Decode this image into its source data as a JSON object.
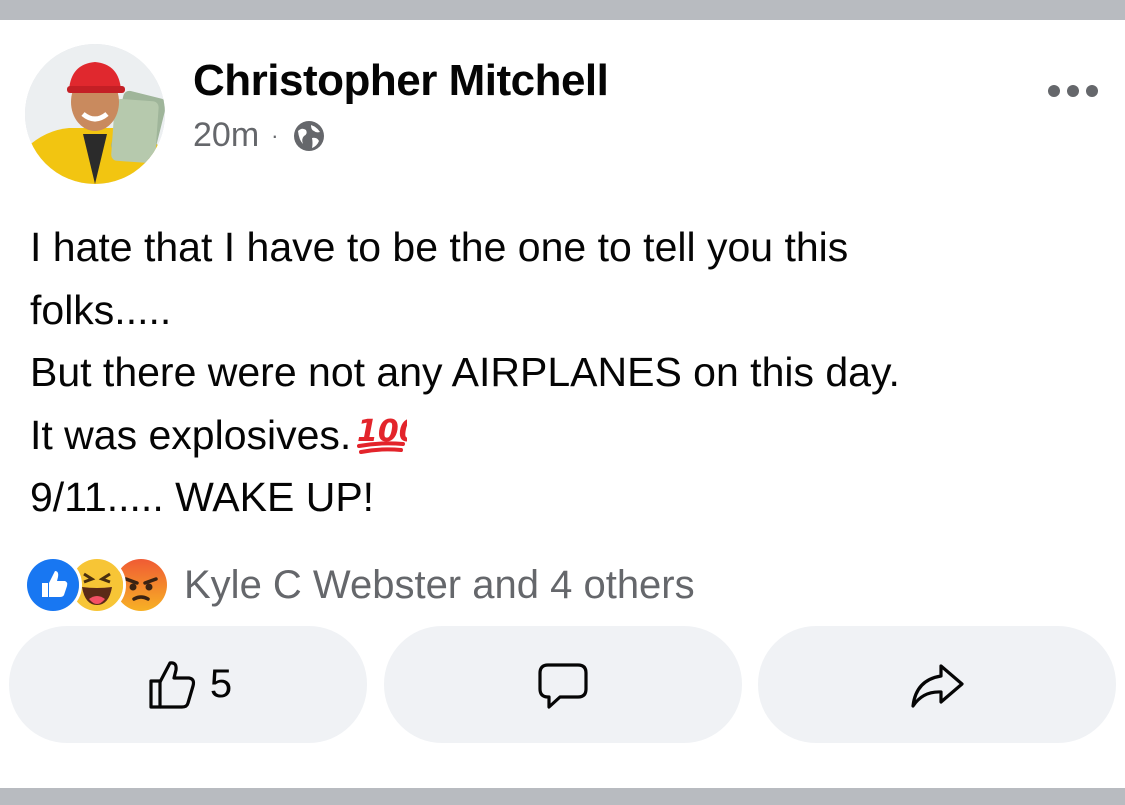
{
  "post": {
    "author": "Christopher Mitchell",
    "timestamp": "20m",
    "separator": "·",
    "audience_icon": "globe-icon",
    "more_icon": "more-options-icon",
    "text_lines": [
      "I hate that I have to be the one to tell you this",
      "folks.....",
      "But there were not any AIRPLANES on this day.",
      "It was explosives.",
      "9/11..... WAKE UP!"
    ],
    "emoji": "hundred-points-icon"
  },
  "reactions": {
    "icons": [
      "like-reaction-icon",
      "haha-reaction-icon",
      "angry-reaction-icon"
    ],
    "summary": "Kyle C Webster and 4 others"
  },
  "actions": {
    "like_count": "5",
    "like_icon": "thumbs-up-icon",
    "comment_icon": "comment-icon",
    "share_icon": "share-icon"
  },
  "colors": {
    "meta_text": "#65676b",
    "button_bg": "#f0f2f5",
    "divider": "#b8bbc0",
    "like_blue": "#1877f2"
  }
}
